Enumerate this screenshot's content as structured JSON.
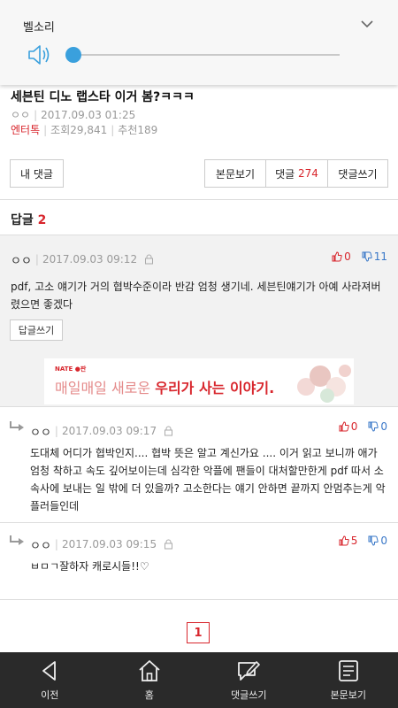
{
  "volume": {
    "title": "벨소리",
    "level": 0
  },
  "article": {
    "title": "세븐틴 디노 랩스타 이거 봄?ㅋㅋㅋ",
    "author": "ㅇㅇ",
    "date": "2017.09.03 01:25",
    "category": "엔터톡",
    "views": "조회29,841",
    "recommends": "추천189"
  },
  "toolbar": {
    "my_comments": "내 댓글",
    "view_body": "본문보기",
    "comments_label": "댓글",
    "comments_count": "274",
    "write_comment": "댓글쓰기"
  },
  "replies": {
    "label": "답글",
    "count": "2"
  },
  "comments": [
    {
      "nick": "ㅇㅇ",
      "date": "2017.09.03 09:12",
      "up": "0",
      "down": "11",
      "body": "pdf, 고소 얘기가 거의 협박수준이라 반감 엄청 생기네. 세븐틴얘기가 아예 사라져버렸으면 좋겠다",
      "reply_button": "답글쓰기"
    },
    {
      "nick": "ㅇㅇ",
      "date": "2017.09.03 09:17",
      "up": "0",
      "down": "0",
      "body": "도대체 어디가 협박인지.... 협박 뜻은 알고 계신가요 .... 이거 읽고 보니까 애가 엄청 착하고 속도 깊어보이는데 심각한 악플에 팬들이 대처할만한게 pdf 따서 소속사에 보내는 일 밖에 더 있을까? 고소한다는 얘기 안하면 끝까지 안멈추는게 악플러들인데"
    },
    {
      "nick": "ㅇㅇ",
      "date": "2017.09.03 09:15",
      "up": "5",
      "down": "0",
      "body": "ㅂㅁㄱ잘하자 캐로시들!!♡"
    }
  ],
  "ad": {
    "brand": "NATE ●판",
    "text_plain": "매일매일 새로운 ",
    "text_bold": "우리가 사는 이야기."
  },
  "pagination": {
    "current": "1"
  },
  "bottom_nav": [
    {
      "label": "이전",
      "icon": "back-icon"
    },
    {
      "label": "홈",
      "icon": "home-icon"
    },
    {
      "label": "댓글쓰기",
      "icon": "write-comment-icon"
    },
    {
      "label": "본문보기",
      "icon": "document-icon"
    }
  ],
  "colors": {
    "accent_red": "#d8262d",
    "accent_blue": "#3aa0dd",
    "down_blue": "#3a78c8",
    "bar_bg": "#2a2a2a"
  }
}
